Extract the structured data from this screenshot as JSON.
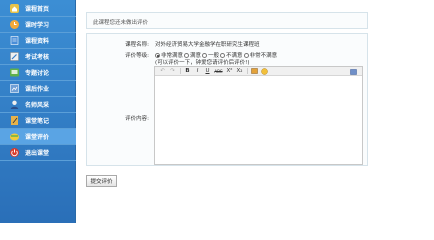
{
  "sidebar": {
    "items": [
      {
        "label": "课程首页",
        "icon": "home-icon",
        "color": "#e8c34a"
      },
      {
        "label": "课时学习",
        "icon": "clock-icon",
        "color": "#f2a93b"
      },
      {
        "label": "课程资料",
        "icon": "book-icon",
        "color": "#4a8ed8"
      },
      {
        "label": "考试考核",
        "icon": "edit-icon",
        "color": "#f0f0f0"
      },
      {
        "label": "专题讨论",
        "icon": "discussion-icon",
        "color": "#5fb04a"
      },
      {
        "label": "课后作业",
        "icon": "homework-icon",
        "color": "#6f9fd6"
      },
      {
        "label": "名师风采",
        "icon": "teacher-icon",
        "color": "#f0f0f0"
      },
      {
        "label": "课堂笔记",
        "icon": "notebook-icon",
        "color": "#e6b24a"
      },
      {
        "label": "课堂评价",
        "icon": "evaluation-icon",
        "color": "#f1cc3a",
        "active": true
      },
      {
        "label": "退出课堂",
        "icon": "exit-icon",
        "color": "#d83b2b"
      }
    ]
  },
  "notice": "此课程您还未做出评价",
  "form": {
    "course_name_label": "课程名称:",
    "course_name_value": "对外经济贸易大学金融学在职研究生课程班",
    "rating_label": "评价等级:",
    "rating_options": [
      "非常满意",
      "满意",
      "一般",
      "不满意",
      "非常不满意"
    ],
    "rating_selected": "非常满意",
    "hint": "(可以评价一下，钟爱您请评价后评价!)",
    "content_label": "评价内容:"
  },
  "editor": {
    "toolbar": {
      "undo": "↶",
      "redo": "↷",
      "bold": "B",
      "italic": "I",
      "underline": "U",
      "strike": "ABC",
      "superscript": "X²",
      "subscript": "X₂"
    }
  },
  "submit_label": "提交评价"
}
